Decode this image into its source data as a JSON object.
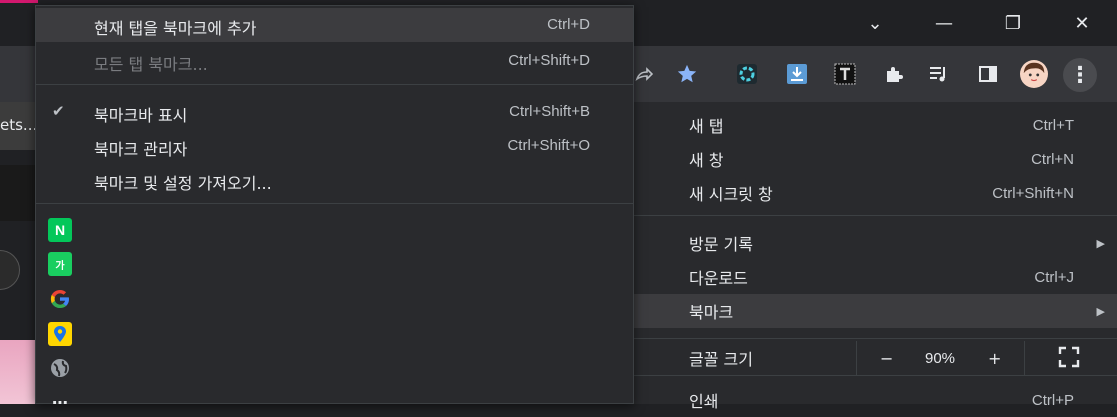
{
  "window": {
    "minimize_glyph": "—",
    "restore_glyph": "❐",
    "close_glyph": "✕",
    "tab_list_glyph": "⌄"
  },
  "toolbar": {
    "menu_glyph": "⋮"
  },
  "left_page": {
    "tab_text": "ets..."
  },
  "bookmark_menu": {
    "items": [
      {
        "label": "현재 탭을 북마크에 추가",
        "shortcut": "Ctrl+D",
        "disabled": false
      },
      {
        "label": "모든 탭 북마크...",
        "shortcut": "Ctrl+Shift+D",
        "disabled": true
      },
      {
        "label": "북마크바 표시",
        "shortcut": "Ctrl+Shift+B",
        "checked": true
      },
      {
        "label": "북마크 관리자",
        "shortcut": "Ctrl+Shift+O"
      },
      {
        "label": "북마크 및 설정 가져오기...",
        "shortcut": ""
      }
    ],
    "check_glyph": "✔",
    "favicons": [
      {
        "name": "naver",
        "glyph": "N"
      },
      {
        "name": "naver-dictionary",
        "glyph": "가"
      },
      {
        "name": "google",
        "glyph": "G"
      },
      {
        "name": "maps",
        "glyph": "📍"
      },
      {
        "name": "globe",
        "glyph": "🌐"
      },
      {
        "name": "apps",
        "glyph": "⋯"
      }
    ]
  },
  "main_menu": {
    "items": [
      {
        "label": "새 탭",
        "shortcut": "Ctrl+T"
      },
      {
        "label": "새 창",
        "shortcut": "Ctrl+N"
      },
      {
        "label": "새 시크릿 창",
        "shortcut": "Ctrl+Shift+N"
      },
      {
        "label": "방문 기록",
        "shortcut": ""
      },
      {
        "label": "다운로드",
        "shortcut": "Ctrl+J"
      },
      {
        "label": "북마크",
        "shortcut": ""
      },
      {
        "label": "글꼴 크기",
        "shortcut": ""
      },
      {
        "label": "인쇄",
        "shortcut": "Ctrl+P"
      }
    ],
    "submenu_arrow": "▶",
    "zoom": {
      "minus": "−",
      "value": "90%",
      "plus": "+",
      "fullscreen_glyph": "⛶"
    }
  },
  "colors": {
    "menu_bg": "#292a2d",
    "hover_bg": "#3c3c3f",
    "accent_blue": "#8ab4f8"
  }
}
